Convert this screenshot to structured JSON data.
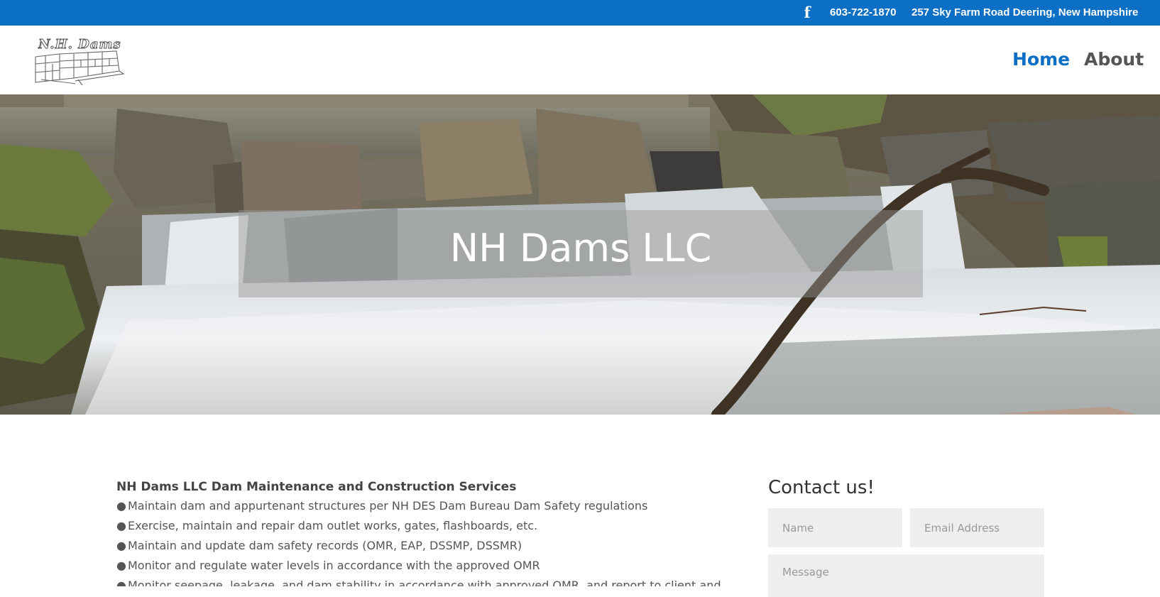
{
  "topbar": {
    "facebook_icon": "facebook-icon",
    "facebook_glyph": "f",
    "phone": "603-722-1870",
    "address": "257 Sky Farm Road Deering, New Hampshire",
    "background": "#0b6fc6"
  },
  "header": {
    "logo_text": "N.H. Dams",
    "nav": {
      "home": "Home",
      "about": "About"
    },
    "accent": "#0b6fc6"
  },
  "hero": {
    "title": "NH Dams LLC"
  },
  "services": {
    "title": "NH Dams LLC Dam Maintenance and Construction Services",
    "bullet": "●",
    "items": [
      "Maintain dam and appurtenant structures per NH DES Dam Bureau Dam Safety regulations",
      "Exercise, maintain and repair dam outlet works, gates, flashboards, etc.",
      "Maintain and update dam safety records (OMR, EAP, DSSMP, DSSMR)",
      "Monitor and regulate water levels in accordance with the approved OMR",
      "Monitor seepage, leakage, and dam stability in accordance with approved OMR, and report to client and"
    ]
  },
  "contact": {
    "title": "Contact us!",
    "name_placeholder": "Name",
    "email_placeholder": "Email Address",
    "message_placeholder": "Message"
  }
}
